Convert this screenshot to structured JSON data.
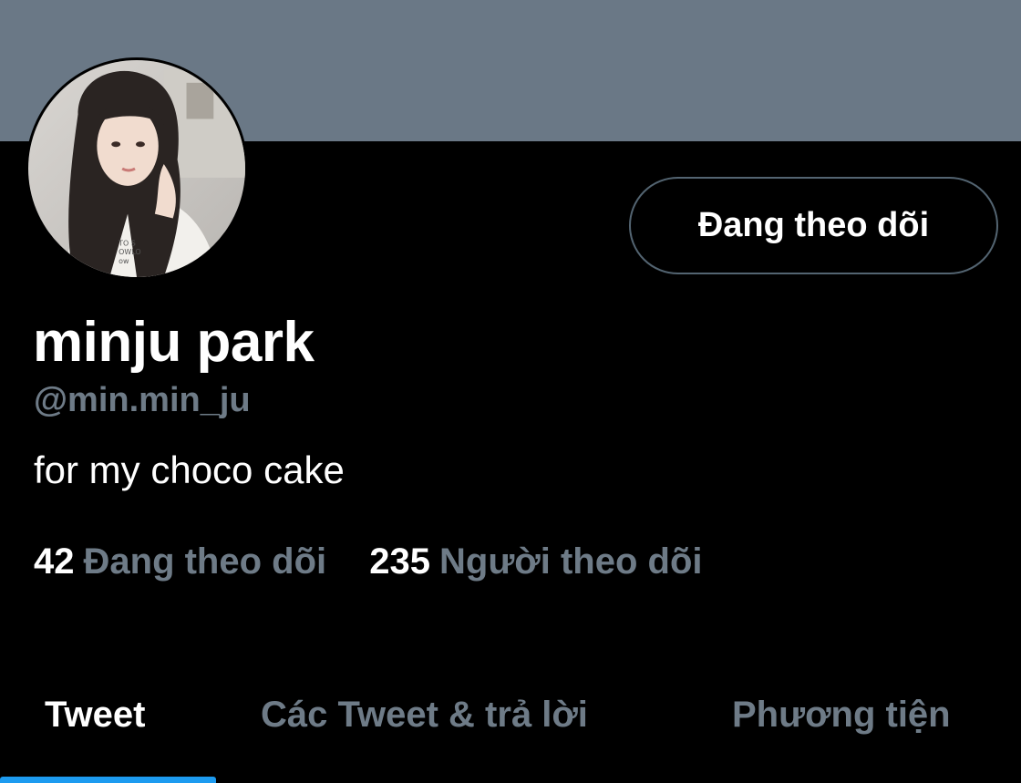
{
  "profile": {
    "name": "minju park",
    "handle": "@min.min_ju",
    "bio": "for my choco cake",
    "follow_button_label": "Đang theo dõi"
  },
  "stats": {
    "following_count": "42",
    "following_label": "Đang theo dõi",
    "followers_count": "235",
    "followers_label": "Người theo dõi"
  },
  "tabs": [
    {
      "label": "Tweet",
      "active": true
    },
    {
      "label": "Các Tweet & trả lời",
      "active": false
    },
    {
      "label": "Phương tiện",
      "active": false
    }
  ],
  "colors": {
    "banner": "#6a7886",
    "background": "#000000",
    "muted_text": "#6e7b87",
    "accent": "#1d9bf0"
  }
}
